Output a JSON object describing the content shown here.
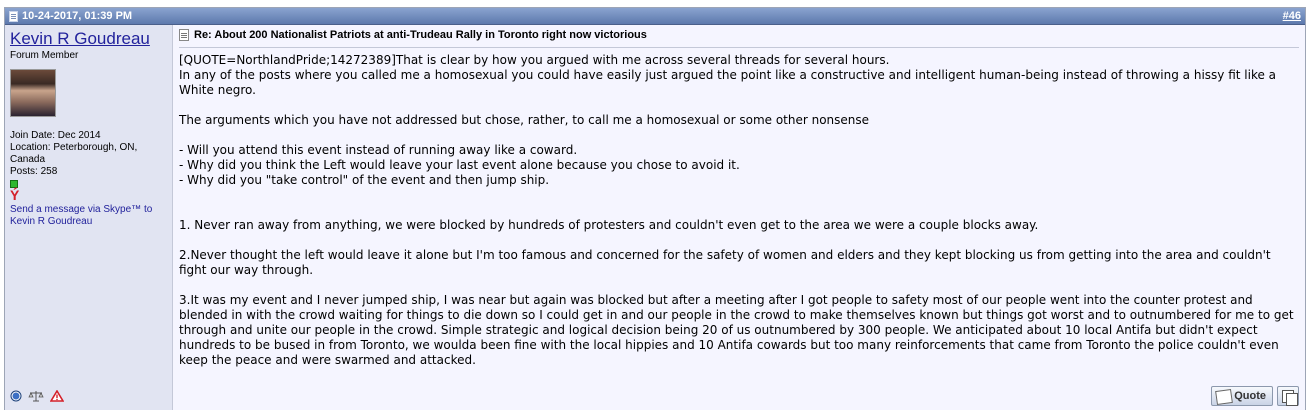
{
  "post": {
    "date": "10-24-2017, 01:39 PM",
    "number": "#46",
    "title": "Re: About 200 Nationalist Patriots at anti-Trudeau Rally in Toronto right now victorious",
    "message": "[QUOTE=NorthlandPride;14272389]That is clear by how you argued with me across several threads for several hours.\nIn any of the posts where you called me a homosexual you could have easily just argued the point like a constructive and intelligent human-being instead of throwing a hissy fit like a White negro.\n\nThe arguments which you have not addressed but chose, rather, to call me a homosexual or some other nonsense\n\n- Will you attend this event instead of running away like a coward.\n- Why did you think the Left would leave your last event alone because you chose to avoid it.\n- Why did you \"take control\" of the event and then jump ship.\n\n\n1. Never ran away from anything, we were blocked by hundreds of protesters and couldn't even get to the area we were a couple blocks away.\n\n2.Never thought the left would leave it alone but I'm too famous and concerned for the safety of women and elders and they kept blocking us from getting into the area and couldn't fight our way through.\n\n3.It was my event and I never jumped ship, I was near but again was blocked but after a meeting after I got people to safety most of our people went into the counter protest and blended in with the crowd waiting for things to die down so I could get in and our people in the crowd to make themselves known but things got worst and to outnumbered for me to get through and unite our people in the crowd. Simple strategic and logical decision being 20 of us outnumbered by 300 people. We anticipated about 10 local Antifa but didn't expect hundreds to be bused in from Toronto, we woulda been fine with the local hippies and 10 Antifa cowards but too many reinforcements that came from Toronto the police couldn't even keep the peace and were swarmed and attacked."
  },
  "user": {
    "name": "Kevin R Goudreau",
    "title": "Forum Member",
    "join_date": "Join Date: Dec 2014",
    "location": "Location: Peterborough, ON, Canada",
    "posts": "Posts: 258",
    "skype": "Send a message via Skype™ to Kevin R Goudreau"
  },
  "buttons": {
    "quote": "Quote"
  },
  "icons": {
    "header": "post-document-icon",
    "title": "post-title-icon",
    "online": "online-status-icon",
    "reputation": "reputation-icon",
    "actions": [
      "online-circle-icon",
      "ip-scales-icon",
      "report-warning-icon"
    ],
    "multiquote": "multiquote-icon"
  },
  "colors": {
    "header": "#738fbf",
    "user_panel": "#e1e4f2",
    "content_bg": "#f5f5ff",
    "link": "#22229c",
    "report": "#d4202a"
  }
}
